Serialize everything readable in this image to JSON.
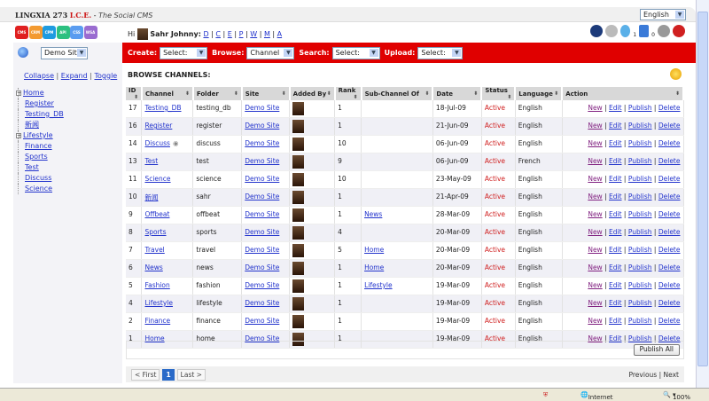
{
  "header": {
    "brand": "LINGXIA 273",
    "brand_accent": "I.C.E.",
    "tagline": "The Social CMS",
    "language": "English"
  },
  "apps": [
    {
      "label": "CMS",
      "color": "#e02020"
    },
    {
      "label": "CRM",
      "color": "#f39a30"
    },
    {
      "label": "CPM",
      "color": "#1e9be0"
    },
    {
      "label": "API",
      "color": "#2cc080"
    },
    {
      "label": "CSS",
      "color": "#5a9cf0"
    },
    {
      "label": "WSA",
      "color": "#9a6cd0"
    }
  ],
  "user": {
    "greeting": "Hi",
    "name": "Sahr Johnny:",
    "links": [
      "D",
      "C",
      "E",
      "P",
      "W",
      "M",
      "A"
    ]
  },
  "toolbar_icons": {
    "updates_count": "1",
    "messages_count": "0"
  },
  "sidebar": {
    "site": "Demo Site",
    "collapse": "Collapse",
    "expand": "Expand",
    "toggle": "Toggle",
    "tree": [
      {
        "label": "Home",
        "expandable": true
      },
      {
        "label": "Register"
      },
      {
        "label": "Testing_DB"
      },
      {
        "label": "新闻"
      },
      {
        "label": "Lifestyle",
        "expandable": true
      },
      {
        "label": "Finance"
      },
      {
        "label": "Sports"
      },
      {
        "label": "Test"
      },
      {
        "label": "Discuss"
      },
      {
        "label": "Science"
      }
    ]
  },
  "actionbar": {
    "create": "Create:",
    "create_value": "Select:",
    "browse": "Browse:",
    "browse_value": "Channel",
    "search": "Search:",
    "search_value": "Select:",
    "upload": "Upload:",
    "upload_value": "Select:"
  },
  "main": {
    "title": "BROWSE CHANNELS:",
    "columns": [
      "ID",
      "Channel",
      "Folder",
      "Site",
      "Added By",
      "Rank",
      "Sub-Channel Of",
      "Date",
      "Status",
      "Language",
      "Action"
    ],
    "actions": [
      "New",
      "Edit",
      "Publish",
      "Delete"
    ],
    "rows": [
      {
        "id": "17",
        "channel": "Testing_DB",
        "folder": "testing_db",
        "site": "Demo Site",
        "rank": "1",
        "sub": "",
        "date": "18-Jul-09",
        "status": "Active",
        "language": "English"
      },
      {
        "id": "16",
        "channel": "Register",
        "folder": "register",
        "site": "Demo Site",
        "rank": "1",
        "sub": "",
        "date": "21-Jun-09",
        "status": "Active",
        "language": "English"
      },
      {
        "id": "14",
        "channel": "Discuss",
        "folder": "discuss",
        "site": "Demo Site",
        "rank": "10",
        "sub": "",
        "date": "06-Jun-09",
        "status": "Active",
        "language": "English"
      },
      {
        "id": "13",
        "channel": "Test",
        "folder": "test",
        "site": "Demo Site",
        "rank": "9",
        "sub": "",
        "date": "06-Jun-09",
        "status": "Active",
        "language": "French"
      },
      {
        "id": "11",
        "channel": "Science",
        "folder": "science",
        "site": "Demo Site",
        "rank": "10",
        "sub": "",
        "date": "23-May-09",
        "status": "Active",
        "language": "English"
      },
      {
        "id": "10",
        "channel": "新闻",
        "folder": "sahr",
        "site": "Demo Site",
        "rank": "1",
        "sub": "",
        "date": "21-Apr-09",
        "status": "Active",
        "language": "English"
      },
      {
        "id": "9",
        "channel": "Offbeat",
        "folder": "offbeat",
        "site": "Demo Site",
        "rank": "1",
        "sub": "News",
        "date": "28-Mar-09",
        "status": "Active",
        "language": "English"
      },
      {
        "id": "8",
        "channel": "Sports",
        "folder": "sports",
        "site": "Demo Site",
        "rank": "4",
        "sub": "",
        "date": "20-Mar-09",
        "status": "Active",
        "language": "English"
      },
      {
        "id": "7",
        "channel": "Travel",
        "folder": "travel",
        "site": "Demo Site",
        "rank": "5",
        "sub": "Home",
        "date": "20-Mar-09",
        "status": "Active",
        "language": "English"
      },
      {
        "id": "6",
        "channel": "News",
        "folder": "news",
        "site": "Demo Site",
        "rank": "1",
        "sub": "Home",
        "date": "20-Mar-09",
        "status": "Active",
        "language": "English"
      },
      {
        "id": "5",
        "channel": "Fashion",
        "folder": "fashion",
        "site": "Demo Site",
        "rank": "1",
        "sub": "Lifestyle",
        "date": "19-Mar-09",
        "status": "Active",
        "language": "English"
      },
      {
        "id": "4",
        "channel": "Lifestyle",
        "folder": "lifestyle",
        "site": "Demo Site",
        "rank": "1",
        "sub": "",
        "date": "19-Mar-09",
        "status": "Active",
        "language": "English"
      },
      {
        "id": "2",
        "channel": "Finance",
        "folder": "finance",
        "site": "Demo Site",
        "rank": "1",
        "sub": "",
        "date": "19-Mar-09",
        "status": "Active",
        "language": "English"
      },
      {
        "id": "1",
        "channel": "Home",
        "folder": "home",
        "site": "Demo Site",
        "rank": "1",
        "sub": "",
        "date": "19-Mar-09",
        "status": "Active",
        "language": "English"
      }
    ],
    "publish_all": "Publish All"
  },
  "pager": {
    "first": "< First",
    "page": "1",
    "last": "Last >",
    "previous": "Previous",
    "next": "Next",
    "sep": "|"
  },
  "statusbar": {
    "zone": "Internet",
    "zoom": "100%"
  }
}
